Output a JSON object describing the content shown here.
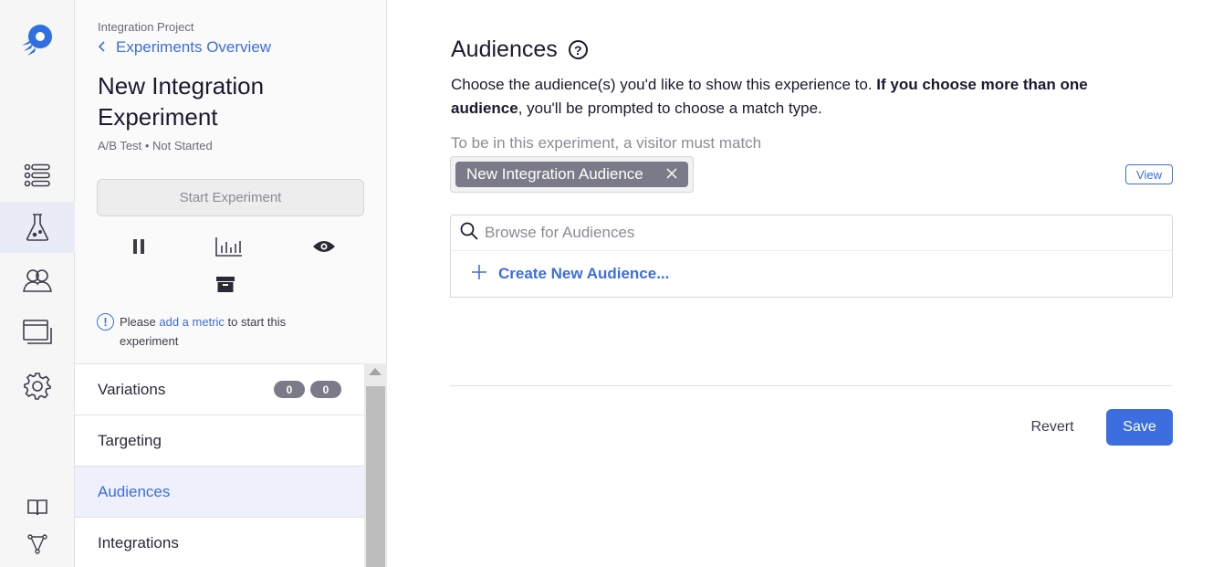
{
  "sidebar": {
    "project": "Integration Project",
    "back_label": "Experiments Overview",
    "experiment_title": "New Integration Experiment",
    "experiment_type": "A/B Test",
    "experiment_status": "Not Started",
    "start_button": "Start Experiment",
    "notice": {
      "prefix": "Please ",
      "link": "add a metric",
      "suffix": " to start this experiment"
    },
    "nav": [
      {
        "label": "Variations",
        "badges": [
          "0",
          "0"
        ]
      },
      {
        "label": "Targeting"
      },
      {
        "label": "Audiences"
      },
      {
        "label": "Integrations"
      }
    ]
  },
  "main": {
    "heading": "Audiences",
    "help_glyph": "?",
    "description_plain": "Choose the audience(s) you'd like to show this experience to. ",
    "description_bold": "If you choose more than one audience",
    "description_tail": ", you'll be prompted to choose a match type.",
    "match_label": "To be in this experiment, a visitor must match",
    "selected_audience": "New Integration Audience",
    "view_button": "View",
    "search_placeholder": "Browse for Audiences",
    "create_label": "Create New Audience...",
    "revert_label": "Revert",
    "save_label": "Save"
  },
  "rail": {
    "icons": [
      "logo-icon",
      "list-icon",
      "flask-icon",
      "users-icon",
      "windows-icon",
      "gear-icon",
      "book-icon",
      "network-icon"
    ],
    "active": "flask-icon"
  },
  "colors": {
    "accent": "#3d6ee0",
    "tag": "#7a7a88",
    "rail_bg": "#f6f6f7"
  }
}
